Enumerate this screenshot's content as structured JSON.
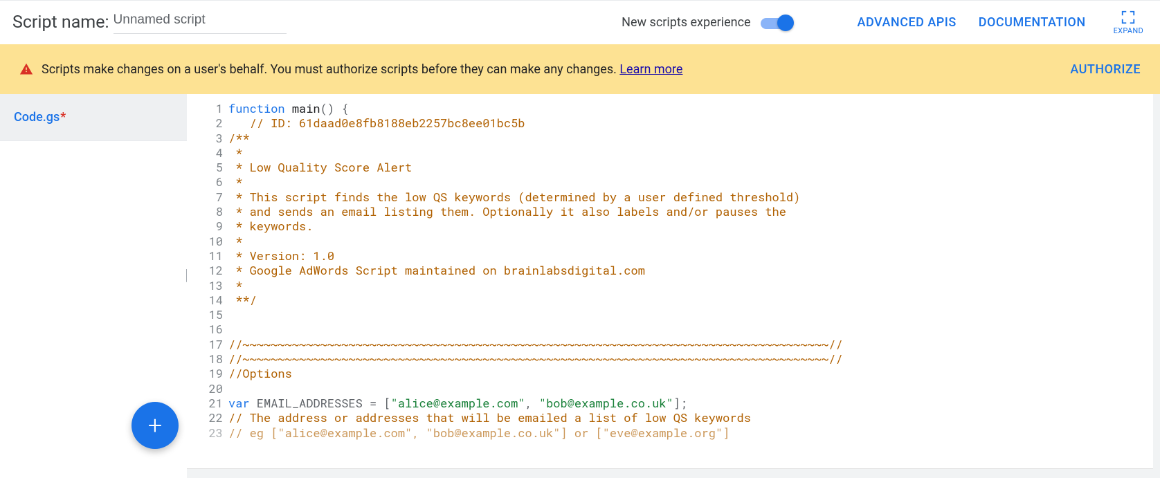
{
  "header": {
    "script_label": "Script name:",
    "script_name_value": "Unnamed script",
    "toggle_label": "New scripts experience",
    "toggle_on": true,
    "advanced_apis": "ADVANCED APIS",
    "documentation": "DOCUMENTATION",
    "expand": "EXPAND"
  },
  "banner": {
    "text": "Scripts make changes on a user's behalf. You must authorize scripts before they can make any changes. ",
    "learn_more": "Learn more",
    "authorize": "AUTHORIZE"
  },
  "sidebar": {
    "file_name": "Code.gs",
    "modified_marker": "*",
    "fab_label": "+"
  },
  "editor": {
    "line_count": 23,
    "lines": [
      {
        "n": 1,
        "t": "function main() {",
        "tokens": [
          [
            "kw",
            "function"
          ],
          [
            "punc",
            " "
          ],
          [
            "fn",
            "main"
          ],
          [
            "punc",
            "() {"
          ]
        ]
      },
      {
        "n": 2,
        "t": "   // ID: 61daad0e8fb8188eb2257bc8ee01bc5b",
        "tokens": [
          [
            "punc",
            "   "
          ],
          [
            "cmt",
            "// ID: 61daad0e8fb8188eb2257bc8ee01bc5b"
          ]
        ]
      },
      {
        "n": 3,
        "t": "/**",
        "tokens": [
          [
            "cmt",
            "/**"
          ]
        ]
      },
      {
        "n": 4,
        "t": " *",
        "tokens": [
          [
            "cmt",
            " *"
          ]
        ]
      },
      {
        "n": 5,
        "t": " * Low Quality Score Alert",
        "tokens": [
          [
            "cmt",
            " * Low Quality Score Alert"
          ]
        ]
      },
      {
        "n": 6,
        "t": " *",
        "tokens": [
          [
            "cmt",
            " *"
          ]
        ]
      },
      {
        "n": 7,
        "t": " * This script finds the low QS keywords (determined by a user defined threshold)",
        "tokens": [
          [
            "cmt",
            " * This script finds the low QS keywords (determined by a user defined threshold)"
          ]
        ]
      },
      {
        "n": 8,
        "t": " * and sends an email listing them. Optionally it also labels and/or pauses the",
        "tokens": [
          [
            "cmt",
            " * and sends an email listing them. Optionally it also labels and/or pauses the"
          ]
        ]
      },
      {
        "n": 9,
        "t": " * keywords.",
        "tokens": [
          [
            "cmt",
            " * keywords."
          ]
        ]
      },
      {
        "n": 10,
        "t": " *",
        "tokens": [
          [
            "cmt",
            " *"
          ]
        ]
      },
      {
        "n": 11,
        "t": " * Version: 1.0",
        "tokens": [
          [
            "cmt",
            " * Version: 1.0"
          ]
        ]
      },
      {
        "n": 12,
        "t": " * Google AdWords Script maintained on brainlabsdigital.com",
        "tokens": [
          [
            "cmt",
            " * Google AdWords Script maintained on brainlabsdigital.com"
          ]
        ]
      },
      {
        "n": 13,
        "t": " *",
        "tokens": [
          [
            "cmt",
            " *"
          ]
        ]
      },
      {
        "n": 14,
        "t": " **/",
        "tokens": [
          [
            "cmt",
            " **/"
          ]
        ]
      },
      {
        "n": 15,
        "t": "",
        "tokens": []
      },
      {
        "n": 16,
        "t": "",
        "tokens": []
      },
      {
        "n": 17,
        "t": "//~~~~~~~~~~~~~~~~~~~~~~~~~~~~~~~~~~~~~~~~~~~~~~~~~~~~~~~~~~~~~~~~~~~~~~~~~~~~~~~~~~~//",
        "tokens": [
          [
            "cmt",
            "//~~~~~~~~~~~~~~~~~~~~~~~~~~~~~~~~~~~~~~~~~~~~~~~~~~~~~~~~~~~~~~~~~~~~~~~~~~~~~~~~~~~//"
          ]
        ]
      },
      {
        "n": 18,
        "t": "//~~~~~~~~~~~~~~~~~~~~~~~~~~~~~~~~~~~~~~~~~~~~~~~~~~~~~~~~~~~~~~~~~~~~~~~~~~~~~~~~~~~//",
        "tokens": [
          [
            "cmt",
            "//~~~~~~~~~~~~~~~~~~~~~~~~~~~~~~~~~~~~~~~~~~~~~~~~~~~~~~~~~~~~~~~~~~~~~~~~~~~~~~~~~~~//"
          ]
        ]
      },
      {
        "n": 19,
        "t": "//Options",
        "tokens": [
          [
            "cmt",
            "//Options"
          ]
        ]
      },
      {
        "n": 20,
        "t": "",
        "tokens": []
      },
      {
        "n": 21,
        "t": "var EMAIL_ADDRESSES = [\"alice@example.com\", \"bob@example.co.uk\"];",
        "tokens": [
          [
            "kw",
            "var"
          ],
          [
            "punc",
            " EMAIL_ADDRESSES = ["
          ],
          [
            "str",
            "\"alice@example.com\""
          ],
          [
            "punc",
            ", "
          ],
          [
            "str",
            "\"bob@example.co.uk\""
          ],
          [
            "punc",
            "];"
          ]
        ]
      },
      {
        "n": 22,
        "t": "// The address or addresses that will be emailed a list of low QS keywords",
        "tokens": [
          [
            "cmt",
            "// The address or addresses that will be emailed a list of low QS keywords"
          ]
        ]
      },
      {
        "n": 23,
        "t": "// eg [\"alice@example.com\", \"bob@example.co.uk\"] or [\"eve@example.org\"]",
        "tokens": [
          [
            "cmt",
            "// eg [\"alice@example.com\", \"bob@example.co.uk\"] or [\"eve@example.org\"]"
          ]
        ]
      }
    ]
  }
}
